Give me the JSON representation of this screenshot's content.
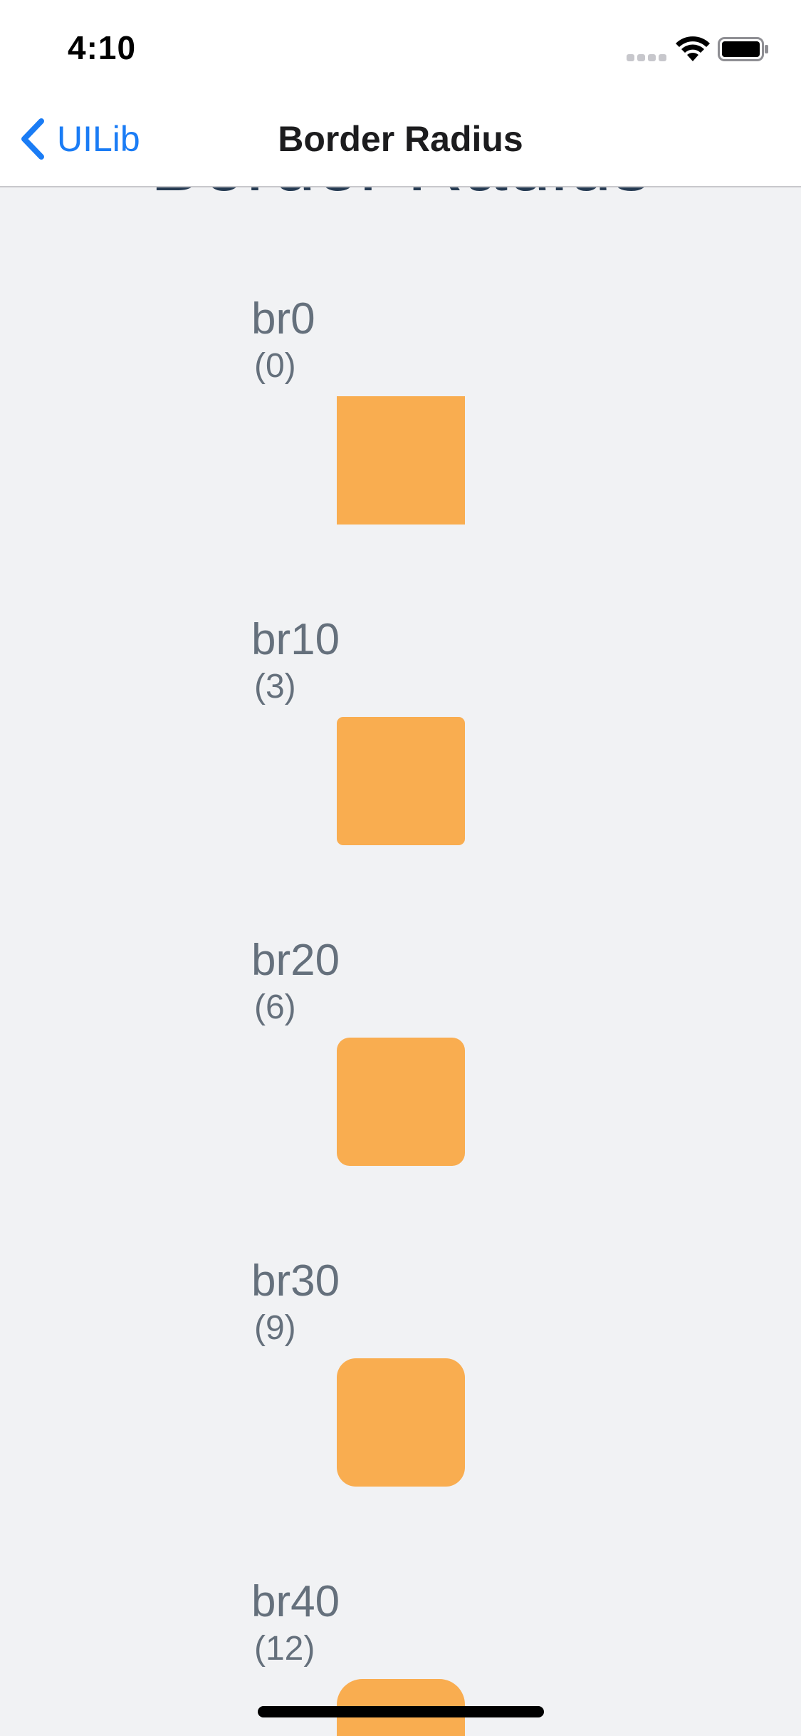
{
  "status_bar": {
    "time": "4:10",
    "icons": [
      "signal-icon",
      "wifi-icon",
      "battery-icon"
    ]
  },
  "nav": {
    "back_label": "UILib",
    "title": "Border Radius"
  },
  "page": {
    "heading": "Border Radius"
  },
  "items": [
    {
      "name": "br0",
      "value": "(0)",
      "radius": 0
    },
    {
      "name": "br10",
      "value": "(3)",
      "radius": 3
    },
    {
      "name": "br20",
      "value": "(6)",
      "radius": 6
    },
    {
      "name": "br30",
      "value": "(9)",
      "radius": 9
    },
    {
      "name": "br40",
      "value": "(12)",
      "radius": 12
    }
  ],
  "colors": {
    "accent": "#1a7cf5",
    "swatch": "#f9ad50",
    "background": "#f1f2f4",
    "heading": "#253a52",
    "label": "#65707c"
  }
}
